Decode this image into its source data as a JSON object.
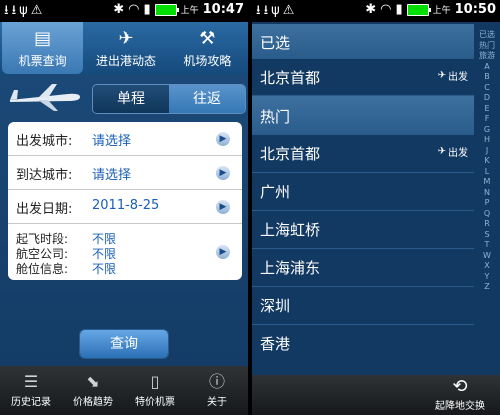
{
  "status": {
    "left": {
      "ampm": "上午",
      "time": "10:47"
    },
    "right": {
      "ampm": "上午",
      "time": "10:50"
    }
  },
  "left_screen": {
    "tabs": [
      {
        "label": "机票查询",
        "icon": "ticket-icon"
      },
      {
        "label": "进出港动态",
        "icon": "airplane-icon"
      },
      {
        "label": "机场攻略",
        "icon": "tools-icon"
      }
    ],
    "trip_type": {
      "one_way": "单程",
      "round_trip": "往返"
    },
    "form": {
      "departure_label": "出发城市:",
      "departure_value": "请选择",
      "arrival_label": "到达城市:",
      "arrival_value": "请选择",
      "date_label": "出发日期:",
      "date_value": "2011-8-25",
      "time_label": "起飞时段:",
      "time_value": "不限",
      "airline_label": "航空公司:",
      "airline_value": "不限",
      "cabin_label": "舱位信息:",
      "cabin_value": "不限"
    },
    "query_button": "查询",
    "bottom_tabs": [
      {
        "label": "历史记录",
        "icon": "list-icon"
      },
      {
        "label": "价格趋势",
        "icon": "trend-icon"
      },
      {
        "label": "特价机票",
        "icon": "document-icon"
      },
      {
        "label": "关于",
        "icon": "info-icon"
      }
    ]
  },
  "right_screen": {
    "selected_header": "已选",
    "selected": [
      {
        "name": "北京首都",
        "tag": "出发"
      }
    ],
    "hot_header": "热门",
    "hot": [
      {
        "name": "北京首都",
        "tag": "出发"
      },
      {
        "name": "广州",
        "tag": ""
      },
      {
        "name": "上海虹桥",
        "tag": ""
      },
      {
        "name": "上海浦东",
        "tag": ""
      },
      {
        "name": "深圳",
        "tag": ""
      },
      {
        "name": "香港",
        "tag": ""
      }
    ],
    "alpha_index": [
      "已选",
      "热门",
      "旅游",
      "A",
      "B",
      "C",
      "D",
      "E",
      "F",
      "G",
      "H",
      "J",
      "K",
      "L",
      "M",
      "N",
      "P",
      "Q",
      "R",
      "S",
      "T",
      "W",
      "X",
      "Y",
      "Z"
    ],
    "swap_label": "起降地交换"
  }
}
